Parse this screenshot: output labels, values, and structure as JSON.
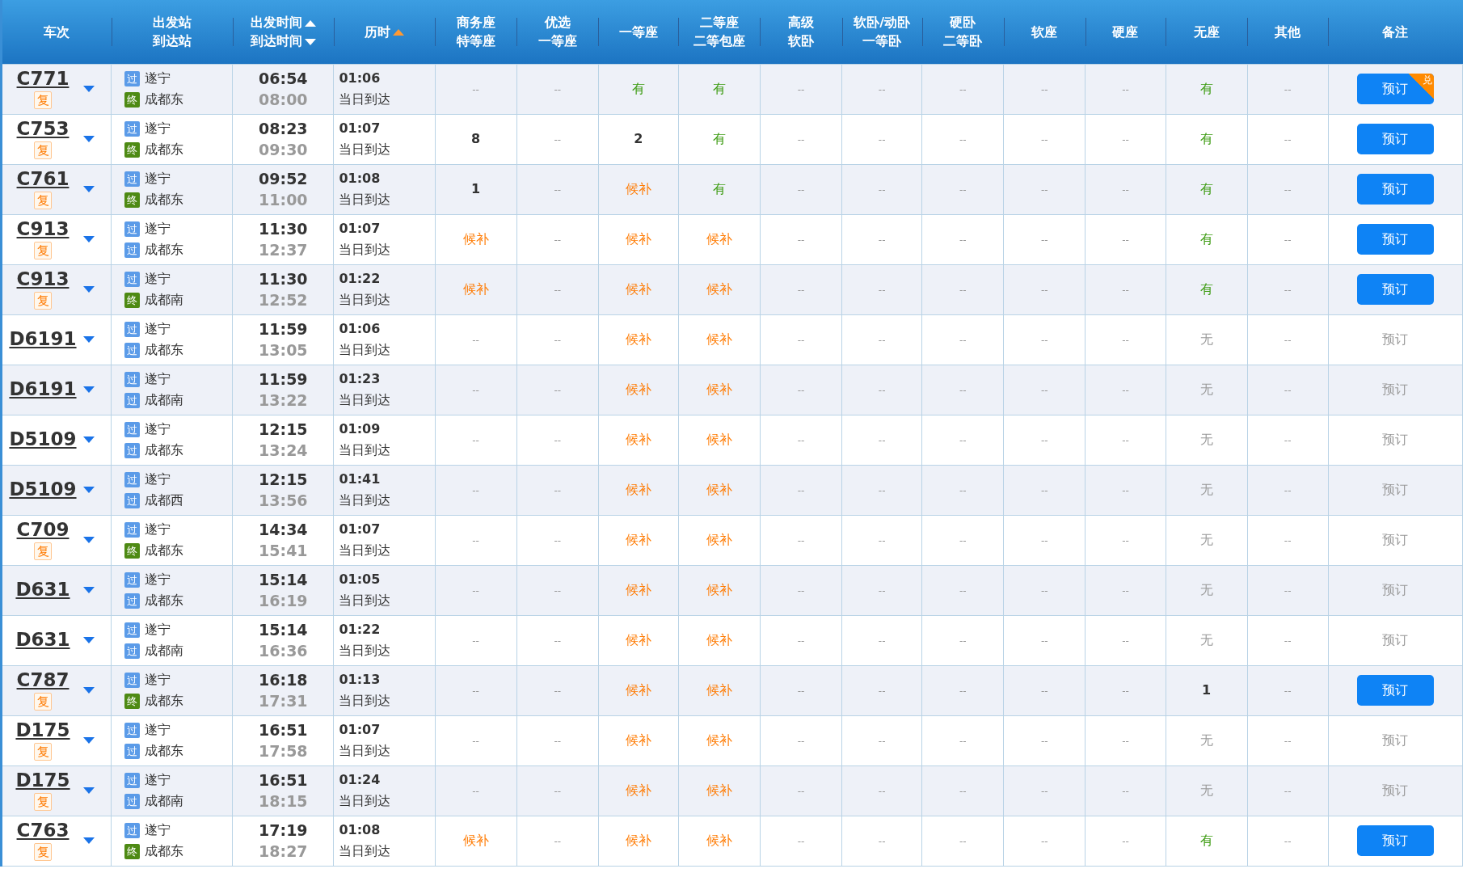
{
  "header": [
    {
      "lines": [
        "车次"
      ]
    },
    {
      "lines": [
        "出发站",
        "到达站"
      ]
    },
    {
      "lines": [
        "出发时间",
        "到达时间"
      ],
      "sorts": [
        {
          "kind": "up",
          "active": false
        },
        {
          "kind": "down",
          "active": false
        }
      ]
    },
    {
      "lines": [
        "历时"
      ],
      "sorts": [
        {
          "kind": "up",
          "active": true
        }
      ]
    },
    {
      "lines": [
        "商务座",
        "特等座"
      ]
    },
    {
      "lines": [
        "优选",
        "一等座"
      ]
    },
    {
      "lines": [
        "一等座"
      ]
    },
    {
      "lines": [
        "二等座",
        "二等包座"
      ]
    },
    {
      "lines": [
        "高级",
        "软卧"
      ]
    },
    {
      "lines": [
        "软卧/动卧",
        "一等卧"
      ]
    },
    {
      "lines": [
        "硬卧",
        "二等卧"
      ]
    },
    {
      "lines": [
        "软座"
      ]
    },
    {
      "lines": [
        "硬座"
      ]
    },
    {
      "lines": [
        "无座"
      ]
    },
    {
      "lines": [
        "其他"
      ]
    },
    {
      "lines": [
        "备注"
      ]
    }
  ],
  "rows": [
    {
      "train": "C771",
      "tag": "复",
      "from": {
        "tag": "过",
        "kind": "pass",
        "name": "遂宁"
      },
      "to": {
        "tag": "终",
        "kind": "end",
        "name": "成都东"
      },
      "depart": "06:54",
      "arrive": "08:00",
      "duration": "01:06",
      "arrival_note": "当日到达",
      "seats": [
        {
          "text": "--",
          "kind": "none"
        },
        {
          "text": "--",
          "kind": "none"
        },
        {
          "text": "有",
          "kind": "yes"
        },
        {
          "text": "有",
          "kind": "yes"
        },
        {
          "text": "--",
          "kind": "none"
        },
        {
          "text": "--",
          "kind": "none"
        },
        {
          "text": "--",
          "kind": "none"
        },
        {
          "text": "--",
          "kind": "none"
        },
        {
          "text": "--",
          "kind": "none"
        },
        {
          "text": "有",
          "kind": "yes"
        },
        {
          "text": "--",
          "kind": "none"
        }
      ],
      "button": {
        "label": "预订",
        "enabled": true,
        "badge": "兑"
      }
    },
    {
      "train": "C753",
      "tag": "复",
      "from": {
        "tag": "过",
        "kind": "pass",
        "name": "遂宁"
      },
      "to": {
        "tag": "终",
        "kind": "end",
        "name": "成都东"
      },
      "depart": "08:23",
      "arrive": "09:30",
      "duration": "01:07",
      "arrival_note": "当日到达",
      "seats": [
        {
          "text": "8",
          "kind": "num"
        },
        {
          "text": "--",
          "kind": "none"
        },
        {
          "text": "2",
          "kind": "num"
        },
        {
          "text": "有",
          "kind": "yes"
        },
        {
          "text": "--",
          "kind": "none"
        },
        {
          "text": "--",
          "kind": "none"
        },
        {
          "text": "--",
          "kind": "none"
        },
        {
          "text": "--",
          "kind": "none"
        },
        {
          "text": "--",
          "kind": "none"
        },
        {
          "text": "有",
          "kind": "yes"
        },
        {
          "text": "--",
          "kind": "none"
        }
      ],
      "button": {
        "label": "预订",
        "enabled": true
      }
    },
    {
      "train": "C761",
      "tag": "复",
      "from": {
        "tag": "过",
        "kind": "pass",
        "name": "遂宁"
      },
      "to": {
        "tag": "终",
        "kind": "end",
        "name": "成都东"
      },
      "depart": "09:52",
      "arrive": "11:00",
      "duration": "01:08",
      "arrival_note": "当日到达",
      "seats": [
        {
          "text": "1",
          "kind": "num"
        },
        {
          "text": "--",
          "kind": "none"
        },
        {
          "text": "候补",
          "kind": "wait"
        },
        {
          "text": "有",
          "kind": "yes"
        },
        {
          "text": "--",
          "kind": "none"
        },
        {
          "text": "--",
          "kind": "none"
        },
        {
          "text": "--",
          "kind": "none"
        },
        {
          "text": "--",
          "kind": "none"
        },
        {
          "text": "--",
          "kind": "none"
        },
        {
          "text": "有",
          "kind": "yes"
        },
        {
          "text": "--",
          "kind": "none"
        }
      ],
      "button": {
        "label": "预订",
        "enabled": true
      }
    },
    {
      "train": "C913",
      "tag": "复",
      "from": {
        "tag": "过",
        "kind": "pass",
        "name": "遂宁"
      },
      "to": {
        "tag": "过",
        "kind": "pass",
        "name": "成都东"
      },
      "depart": "11:30",
      "arrive": "12:37",
      "duration": "01:07",
      "arrival_note": "当日到达",
      "seats": [
        {
          "text": "候补",
          "kind": "wait"
        },
        {
          "text": "--",
          "kind": "none"
        },
        {
          "text": "候补",
          "kind": "wait"
        },
        {
          "text": "候补",
          "kind": "wait"
        },
        {
          "text": "--",
          "kind": "none"
        },
        {
          "text": "--",
          "kind": "none"
        },
        {
          "text": "--",
          "kind": "none"
        },
        {
          "text": "--",
          "kind": "none"
        },
        {
          "text": "--",
          "kind": "none"
        },
        {
          "text": "有",
          "kind": "yes"
        },
        {
          "text": "--",
          "kind": "none"
        }
      ],
      "button": {
        "label": "预订",
        "enabled": true
      }
    },
    {
      "train": "C913",
      "tag": "复",
      "from": {
        "tag": "过",
        "kind": "pass",
        "name": "遂宁"
      },
      "to": {
        "tag": "终",
        "kind": "end",
        "name": "成都南"
      },
      "depart": "11:30",
      "arrive": "12:52",
      "duration": "01:22",
      "arrival_note": "当日到达",
      "seats": [
        {
          "text": "候补",
          "kind": "wait"
        },
        {
          "text": "--",
          "kind": "none"
        },
        {
          "text": "候补",
          "kind": "wait"
        },
        {
          "text": "候补",
          "kind": "wait"
        },
        {
          "text": "--",
          "kind": "none"
        },
        {
          "text": "--",
          "kind": "none"
        },
        {
          "text": "--",
          "kind": "none"
        },
        {
          "text": "--",
          "kind": "none"
        },
        {
          "text": "--",
          "kind": "none"
        },
        {
          "text": "有",
          "kind": "yes"
        },
        {
          "text": "--",
          "kind": "none"
        }
      ],
      "button": {
        "label": "预订",
        "enabled": true
      }
    },
    {
      "train": "D6191",
      "from": {
        "tag": "过",
        "kind": "pass",
        "name": "遂宁"
      },
      "to": {
        "tag": "过",
        "kind": "pass",
        "name": "成都东"
      },
      "depart": "11:59",
      "arrive": "13:05",
      "duration": "01:06",
      "arrival_note": "当日到达",
      "seats": [
        {
          "text": "--",
          "kind": "none"
        },
        {
          "text": "--",
          "kind": "none"
        },
        {
          "text": "候补",
          "kind": "wait"
        },
        {
          "text": "候补",
          "kind": "wait"
        },
        {
          "text": "--",
          "kind": "none"
        },
        {
          "text": "--",
          "kind": "none"
        },
        {
          "text": "--",
          "kind": "none"
        },
        {
          "text": "--",
          "kind": "none"
        },
        {
          "text": "--",
          "kind": "none"
        },
        {
          "text": "无",
          "kind": "no"
        },
        {
          "text": "--",
          "kind": "none"
        }
      ],
      "button": {
        "label": "预订",
        "enabled": false
      }
    },
    {
      "train": "D6191",
      "from": {
        "tag": "过",
        "kind": "pass",
        "name": "遂宁"
      },
      "to": {
        "tag": "过",
        "kind": "pass",
        "name": "成都南"
      },
      "depart": "11:59",
      "arrive": "13:22",
      "duration": "01:23",
      "arrival_note": "当日到达",
      "seats": [
        {
          "text": "--",
          "kind": "none"
        },
        {
          "text": "--",
          "kind": "none"
        },
        {
          "text": "候补",
          "kind": "wait"
        },
        {
          "text": "候补",
          "kind": "wait"
        },
        {
          "text": "--",
          "kind": "none"
        },
        {
          "text": "--",
          "kind": "none"
        },
        {
          "text": "--",
          "kind": "none"
        },
        {
          "text": "--",
          "kind": "none"
        },
        {
          "text": "--",
          "kind": "none"
        },
        {
          "text": "无",
          "kind": "no"
        },
        {
          "text": "--",
          "kind": "none"
        }
      ],
      "button": {
        "label": "预订",
        "enabled": false
      }
    },
    {
      "train": "D5109",
      "from": {
        "tag": "过",
        "kind": "pass",
        "name": "遂宁"
      },
      "to": {
        "tag": "过",
        "kind": "pass",
        "name": "成都东"
      },
      "depart": "12:15",
      "arrive": "13:24",
      "duration": "01:09",
      "arrival_note": "当日到达",
      "seats": [
        {
          "text": "--",
          "kind": "none"
        },
        {
          "text": "--",
          "kind": "none"
        },
        {
          "text": "候补",
          "kind": "wait"
        },
        {
          "text": "候补",
          "kind": "wait"
        },
        {
          "text": "--",
          "kind": "none"
        },
        {
          "text": "--",
          "kind": "none"
        },
        {
          "text": "--",
          "kind": "none"
        },
        {
          "text": "--",
          "kind": "none"
        },
        {
          "text": "--",
          "kind": "none"
        },
        {
          "text": "无",
          "kind": "no"
        },
        {
          "text": "--",
          "kind": "none"
        }
      ],
      "button": {
        "label": "预订",
        "enabled": false
      }
    },
    {
      "train": "D5109",
      "from": {
        "tag": "过",
        "kind": "pass",
        "name": "遂宁"
      },
      "to": {
        "tag": "过",
        "kind": "pass",
        "name": "成都西"
      },
      "depart": "12:15",
      "arrive": "13:56",
      "duration": "01:41",
      "arrival_note": "当日到达",
      "seats": [
        {
          "text": "--",
          "kind": "none"
        },
        {
          "text": "--",
          "kind": "none"
        },
        {
          "text": "候补",
          "kind": "wait"
        },
        {
          "text": "候补",
          "kind": "wait"
        },
        {
          "text": "--",
          "kind": "none"
        },
        {
          "text": "--",
          "kind": "none"
        },
        {
          "text": "--",
          "kind": "none"
        },
        {
          "text": "--",
          "kind": "none"
        },
        {
          "text": "--",
          "kind": "none"
        },
        {
          "text": "无",
          "kind": "no"
        },
        {
          "text": "--",
          "kind": "none"
        }
      ],
      "button": {
        "label": "预订",
        "enabled": false
      }
    },
    {
      "train": "C709",
      "tag": "复",
      "from": {
        "tag": "过",
        "kind": "pass",
        "name": "遂宁"
      },
      "to": {
        "tag": "终",
        "kind": "end",
        "name": "成都东"
      },
      "depart": "14:34",
      "arrive": "15:41",
      "duration": "01:07",
      "arrival_note": "当日到达",
      "seats": [
        {
          "text": "--",
          "kind": "none"
        },
        {
          "text": "--",
          "kind": "none"
        },
        {
          "text": "候补",
          "kind": "wait"
        },
        {
          "text": "候补",
          "kind": "wait"
        },
        {
          "text": "--",
          "kind": "none"
        },
        {
          "text": "--",
          "kind": "none"
        },
        {
          "text": "--",
          "kind": "none"
        },
        {
          "text": "--",
          "kind": "none"
        },
        {
          "text": "--",
          "kind": "none"
        },
        {
          "text": "无",
          "kind": "no"
        },
        {
          "text": "--",
          "kind": "none"
        }
      ],
      "button": {
        "label": "预订",
        "enabled": false
      }
    },
    {
      "train": "D631",
      "from": {
        "tag": "过",
        "kind": "pass",
        "name": "遂宁"
      },
      "to": {
        "tag": "过",
        "kind": "pass",
        "name": "成都东"
      },
      "depart": "15:14",
      "arrive": "16:19",
      "duration": "01:05",
      "arrival_note": "当日到达",
      "seats": [
        {
          "text": "--",
          "kind": "none"
        },
        {
          "text": "--",
          "kind": "none"
        },
        {
          "text": "候补",
          "kind": "wait"
        },
        {
          "text": "候补",
          "kind": "wait"
        },
        {
          "text": "--",
          "kind": "none"
        },
        {
          "text": "--",
          "kind": "none"
        },
        {
          "text": "--",
          "kind": "none"
        },
        {
          "text": "--",
          "kind": "none"
        },
        {
          "text": "--",
          "kind": "none"
        },
        {
          "text": "无",
          "kind": "no"
        },
        {
          "text": "--",
          "kind": "none"
        }
      ],
      "button": {
        "label": "预订",
        "enabled": false
      }
    },
    {
      "train": "D631",
      "from": {
        "tag": "过",
        "kind": "pass",
        "name": "遂宁"
      },
      "to": {
        "tag": "过",
        "kind": "pass",
        "name": "成都南"
      },
      "depart": "15:14",
      "arrive": "16:36",
      "duration": "01:22",
      "arrival_note": "当日到达",
      "seats": [
        {
          "text": "--",
          "kind": "none"
        },
        {
          "text": "--",
          "kind": "none"
        },
        {
          "text": "候补",
          "kind": "wait"
        },
        {
          "text": "候补",
          "kind": "wait"
        },
        {
          "text": "--",
          "kind": "none"
        },
        {
          "text": "--",
          "kind": "none"
        },
        {
          "text": "--",
          "kind": "none"
        },
        {
          "text": "--",
          "kind": "none"
        },
        {
          "text": "--",
          "kind": "none"
        },
        {
          "text": "无",
          "kind": "no"
        },
        {
          "text": "--",
          "kind": "none"
        }
      ],
      "button": {
        "label": "预订",
        "enabled": false
      }
    },
    {
      "train": "C787",
      "tag": "复",
      "from": {
        "tag": "过",
        "kind": "pass",
        "name": "遂宁"
      },
      "to": {
        "tag": "终",
        "kind": "end",
        "name": "成都东"
      },
      "depart": "16:18",
      "arrive": "17:31",
      "duration": "01:13",
      "arrival_note": "当日到达",
      "seats": [
        {
          "text": "--",
          "kind": "none"
        },
        {
          "text": "--",
          "kind": "none"
        },
        {
          "text": "候补",
          "kind": "wait"
        },
        {
          "text": "候补",
          "kind": "wait"
        },
        {
          "text": "--",
          "kind": "none"
        },
        {
          "text": "--",
          "kind": "none"
        },
        {
          "text": "--",
          "kind": "none"
        },
        {
          "text": "--",
          "kind": "none"
        },
        {
          "text": "--",
          "kind": "none"
        },
        {
          "text": "1",
          "kind": "num"
        },
        {
          "text": "--",
          "kind": "none"
        }
      ],
      "button": {
        "label": "预订",
        "enabled": true
      }
    },
    {
      "train": "D175",
      "tag": "复",
      "from": {
        "tag": "过",
        "kind": "pass",
        "name": "遂宁"
      },
      "to": {
        "tag": "过",
        "kind": "pass",
        "name": "成都东"
      },
      "depart": "16:51",
      "arrive": "17:58",
      "duration": "01:07",
      "arrival_note": "当日到达",
      "seats": [
        {
          "text": "--",
          "kind": "none"
        },
        {
          "text": "--",
          "kind": "none"
        },
        {
          "text": "候补",
          "kind": "wait"
        },
        {
          "text": "候补",
          "kind": "wait"
        },
        {
          "text": "--",
          "kind": "none"
        },
        {
          "text": "--",
          "kind": "none"
        },
        {
          "text": "--",
          "kind": "none"
        },
        {
          "text": "--",
          "kind": "none"
        },
        {
          "text": "--",
          "kind": "none"
        },
        {
          "text": "无",
          "kind": "no"
        },
        {
          "text": "--",
          "kind": "none"
        }
      ],
      "button": {
        "label": "预订",
        "enabled": false
      }
    },
    {
      "train": "D175",
      "tag": "复",
      "from": {
        "tag": "过",
        "kind": "pass",
        "name": "遂宁"
      },
      "to": {
        "tag": "过",
        "kind": "pass",
        "name": "成都南"
      },
      "depart": "16:51",
      "arrive": "18:15",
      "duration": "01:24",
      "arrival_note": "当日到达",
      "seats": [
        {
          "text": "--",
          "kind": "none"
        },
        {
          "text": "--",
          "kind": "none"
        },
        {
          "text": "候补",
          "kind": "wait"
        },
        {
          "text": "候补",
          "kind": "wait"
        },
        {
          "text": "--",
          "kind": "none"
        },
        {
          "text": "--",
          "kind": "none"
        },
        {
          "text": "--",
          "kind": "none"
        },
        {
          "text": "--",
          "kind": "none"
        },
        {
          "text": "--",
          "kind": "none"
        },
        {
          "text": "无",
          "kind": "no"
        },
        {
          "text": "--",
          "kind": "none"
        }
      ],
      "button": {
        "label": "预订",
        "enabled": false
      }
    },
    {
      "train": "C763",
      "tag": "复",
      "from": {
        "tag": "过",
        "kind": "pass",
        "name": "遂宁"
      },
      "to": {
        "tag": "终",
        "kind": "end",
        "name": "成都东"
      },
      "depart": "17:19",
      "arrive": "18:27",
      "duration": "01:08",
      "arrival_note": "当日到达",
      "seats": [
        {
          "text": "候补",
          "kind": "wait"
        },
        {
          "text": "--",
          "kind": "none"
        },
        {
          "text": "候补",
          "kind": "wait"
        },
        {
          "text": "候补",
          "kind": "wait"
        },
        {
          "text": "--",
          "kind": "none"
        },
        {
          "text": "--",
          "kind": "none"
        },
        {
          "text": "--",
          "kind": "none"
        },
        {
          "text": "--",
          "kind": "none"
        },
        {
          "text": "--",
          "kind": "none"
        },
        {
          "text": "有",
          "kind": "yes"
        },
        {
          "text": "--",
          "kind": "none"
        }
      ],
      "button": {
        "label": "预订",
        "enabled": true
      }
    }
  ]
}
